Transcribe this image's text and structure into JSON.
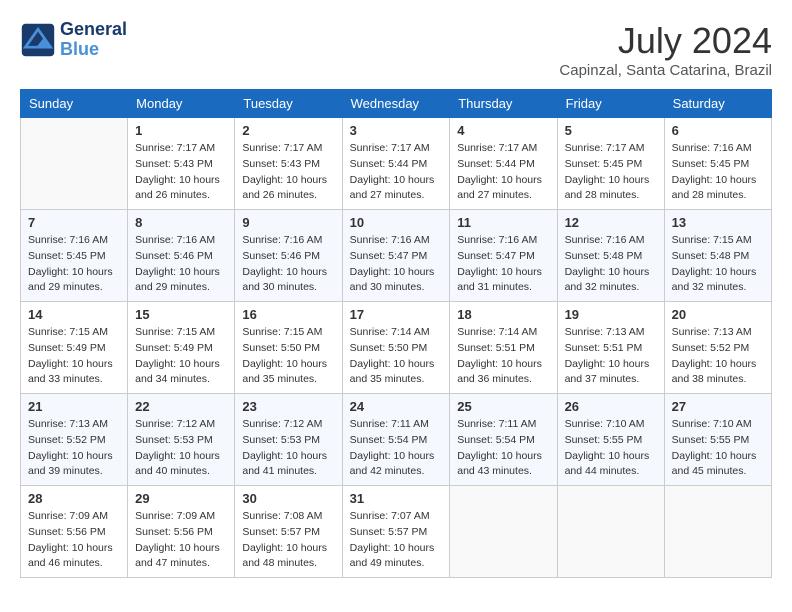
{
  "logo": {
    "line1": "General",
    "line2": "Blue"
  },
  "title": "July 2024",
  "location": "Capinzal, Santa Catarina, Brazil",
  "headers": [
    "Sunday",
    "Monday",
    "Tuesday",
    "Wednesday",
    "Thursday",
    "Friday",
    "Saturday"
  ],
  "weeks": [
    [
      {
        "day": "",
        "info": ""
      },
      {
        "day": "1",
        "info": "Sunrise: 7:17 AM\nSunset: 5:43 PM\nDaylight: 10 hours\nand 26 minutes."
      },
      {
        "day": "2",
        "info": "Sunrise: 7:17 AM\nSunset: 5:43 PM\nDaylight: 10 hours\nand 26 minutes."
      },
      {
        "day": "3",
        "info": "Sunrise: 7:17 AM\nSunset: 5:44 PM\nDaylight: 10 hours\nand 27 minutes."
      },
      {
        "day": "4",
        "info": "Sunrise: 7:17 AM\nSunset: 5:44 PM\nDaylight: 10 hours\nand 27 minutes."
      },
      {
        "day": "5",
        "info": "Sunrise: 7:17 AM\nSunset: 5:45 PM\nDaylight: 10 hours\nand 28 minutes."
      },
      {
        "day": "6",
        "info": "Sunrise: 7:16 AM\nSunset: 5:45 PM\nDaylight: 10 hours\nand 28 minutes."
      }
    ],
    [
      {
        "day": "7",
        "info": "Sunrise: 7:16 AM\nSunset: 5:45 PM\nDaylight: 10 hours\nand 29 minutes."
      },
      {
        "day": "8",
        "info": "Sunrise: 7:16 AM\nSunset: 5:46 PM\nDaylight: 10 hours\nand 29 minutes."
      },
      {
        "day": "9",
        "info": "Sunrise: 7:16 AM\nSunset: 5:46 PM\nDaylight: 10 hours\nand 30 minutes."
      },
      {
        "day": "10",
        "info": "Sunrise: 7:16 AM\nSunset: 5:47 PM\nDaylight: 10 hours\nand 30 minutes."
      },
      {
        "day": "11",
        "info": "Sunrise: 7:16 AM\nSunset: 5:47 PM\nDaylight: 10 hours\nand 31 minutes."
      },
      {
        "day": "12",
        "info": "Sunrise: 7:16 AM\nSunset: 5:48 PM\nDaylight: 10 hours\nand 32 minutes."
      },
      {
        "day": "13",
        "info": "Sunrise: 7:15 AM\nSunset: 5:48 PM\nDaylight: 10 hours\nand 32 minutes."
      }
    ],
    [
      {
        "day": "14",
        "info": "Sunrise: 7:15 AM\nSunset: 5:49 PM\nDaylight: 10 hours\nand 33 minutes."
      },
      {
        "day": "15",
        "info": "Sunrise: 7:15 AM\nSunset: 5:49 PM\nDaylight: 10 hours\nand 34 minutes."
      },
      {
        "day": "16",
        "info": "Sunrise: 7:15 AM\nSunset: 5:50 PM\nDaylight: 10 hours\nand 35 minutes."
      },
      {
        "day": "17",
        "info": "Sunrise: 7:14 AM\nSunset: 5:50 PM\nDaylight: 10 hours\nand 35 minutes."
      },
      {
        "day": "18",
        "info": "Sunrise: 7:14 AM\nSunset: 5:51 PM\nDaylight: 10 hours\nand 36 minutes."
      },
      {
        "day": "19",
        "info": "Sunrise: 7:13 AM\nSunset: 5:51 PM\nDaylight: 10 hours\nand 37 minutes."
      },
      {
        "day": "20",
        "info": "Sunrise: 7:13 AM\nSunset: 5:52 PM\nDaylight: 10 hours\nand 38 minutes."
      }
    ],
    [
      {
        "day": "21",
        "info": "Sunrise: 7:13 AM\nSunset: 5:52 PM\nDaylight: 10 hours\nand 39 minutes."
      },
      {
        "day": "22",
        "info": "Sunrise: 7:12 AM\nSunset: 5:53 PM\nDaylight: 10 hours\nand 40 minutes."
      },
      {
        "day": "23",
        "info": "Sunrise: 7:12 AM\nSunset: 5:53 PM\nDaylight: 10 hours\nand 41 minutes."
      },
      {
        "day": "24",
        "info": "Sunrise: 7:11 AM\nSunset: 5:54 PM\nDaylight: 10 hours\nand 42 minutes."
      },
      {
        "day": "25",
        "info": "Sunrise: 7:11 AM\nSunset: 5:54 PM\nDaylight: 10 hours\nand 43 minutes."
      },
      {
        "day": "26",
        "info": "Sunrise: 7:10 AM\nSunset: 5:55 PM\nDaylight: 10 hours\nand 44 minutes."
      },
      {
        "day": "27",
        "info": "Sunrise: 7:10 AM\nSunset: 5:55 PM\nDaylight: 10 hours\nand 45 minutes."
      }
    ],
    [
      {
        "day": "28",
        "info": "Sunrise: 7:09 AM\nSunset: 5:56 PM\nDaylight: 10 hours\nand 46 minutes."
      },
      {
        "day": "29",
        "info": "Sunrise: 7:09 AM\nSunset: 5:56 PM\nDaylight: 10 hours\nand 47 minutes."
      },
      {
        "day": "30",
        "info": "Sunrise: 7:08 AM\nSunset: 5:57 PM\nDaylight: 10 hours\nand 48 minutes."
      },
      {
        "day": "31",
        "info": "Sunrise: 7:07 AM\nSunset: 5:57 PM\nDaylight: 10 hours\nand 49 minutes."
      },
      {
        "day": "",
        "info": ""
      },
      {
        "day": "",
        "info": ""
      },
      {
        "day": "",
        "info": ""
      }
    ]
  ]
}
